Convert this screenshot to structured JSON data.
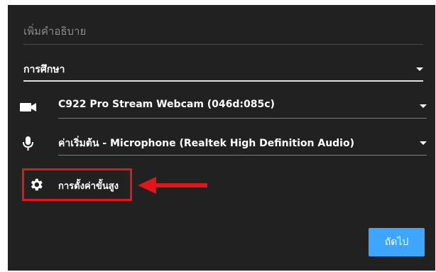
{
  "description": {
    "placeholder": "เพิ่มคำอธิบาย",
    "value": ""
  },
  "category": {
    "selected": "การศึกษา"
  },
  "camera": {
    "icon": "camera-icon",
    "selected": "C922 Pro Stream Webcam (046d:085c)"
  },
  "microphone": {
    "icon": "microphone-icon",
    "selected": "ค่าเริ่มต้น - Microphone (Realtek High Definition Audio)"
  },
  "advanced_settings": {
    "icon": "gear-icon",
    "label": "การตั้งค่าขั้นสูง"
  },
  "next_button": {
    "label": "ถัดไป"
  },
  "colors": {
    "background": "#212121",
    "accent": "#3ea6ff",
    "highlight": "#e0161b"
  }
}
